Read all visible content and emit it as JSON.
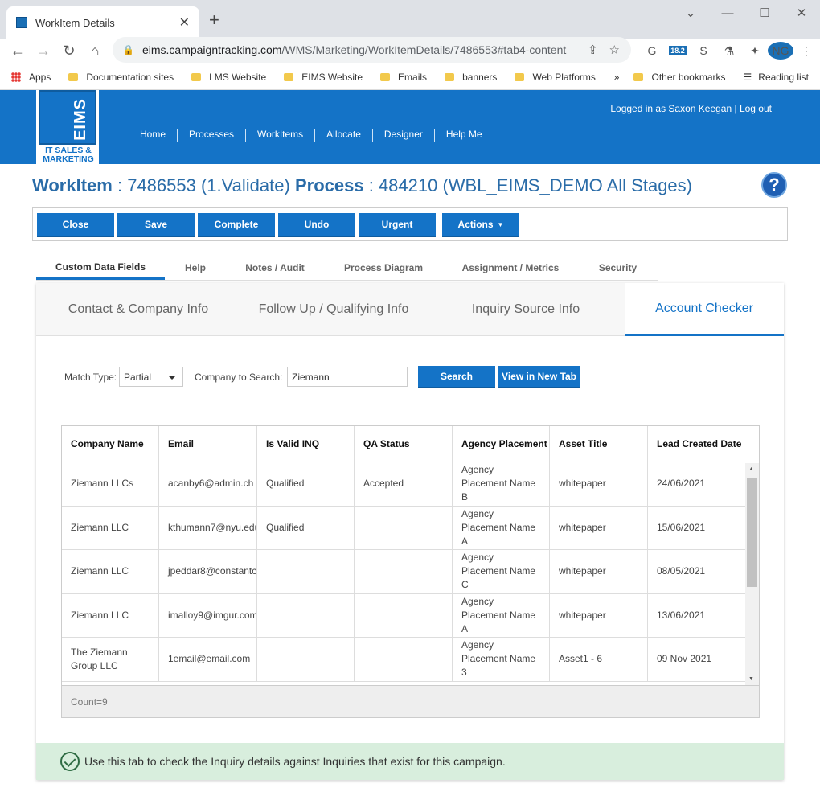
{
  "browser": {
    "tab_title": "WorkItem Details",
    "url_host": "eims.campaigntracking.com",
    "url_path": "/WMS/Marketing/WorkItemDetails/7486553#tab4-content",
    "bookmarks": [
      "Apps",
      "Documentation sites",
      "LMS Website",
      "EIMS Website",
      "Emails",
      "banners",
      "Web Platforms"
    ],
    "other_bookmarks": "Other bookmarks",
    "reading_list": "Reading list",
    "ext_badge": "18.2"
  },
  "header": {
    "logo_text": "EIMS",
    "logo_tagline": "IT SALES & MARKETING",
    "nav": [
      "Home",
      "Processes",
      "WorkItems",
      "Allocate",
      "Designer",
      "Help Me"
    ],
    "logged_in_prefix": "Logged in as",
    "user_name": "Saxon Keegan",
    "logout_label": "| Log out"
  },
  "title": {
    "workitem_label": "WorkItem",
    "workitem_value": ": 7486553 (1.Validate)",
    "process_label": "Process",
    "process_value": ": 484210 (WBL_EIMS_DEMO All Stages)"
  },
  "toolbar": {
    "close": "Close",
    "save": "Save",
    "complete": "Complete",
    "undo": "Undo",
    "urgent": "Urgent",
    "actions": "Actions"
  },
  "subtabs": [
    "Custom Data Fields",
    "Help",
    "Notes / Audit",
    "Process Diagram",
    "Assignment / Metrics",
    "Security"
  ],
  "innertabs": [
    "Contact & Company Info",
    "Follow Up / Qualifying Info",
    "Inquiry Source Info",
    "Account Checker"
  ],
  "search": {
    "match_type_label": "Match Type:",
    "match_type_value": "Partial",
    "company_label": "Company to Search:",
    "company_value": "Ziemann",
    "search_btn": "Search",
    "new_tab_btn": "View in New Tab"
  },
  "grid": {
    "columns": [
      "Company Name",
      "Email",
      "Is Valid INQ",
      "QA Status",
      "Agency Placement",
      "Asset Title",
      "Lead Created Date"
    ],
    "rows": [
      [
        "Ziemann LLCs",
        "acanby6@admin.ch",
        "Qualified",
        "Accepted",
        "Agency Placement Name B",
        "whitepaper",
        "24/06/2021"
      ],
      [
        "Ziemann LLC",
        "kthumann7@nyu.edu",
        "Qualified",
        "",
        "Agency Placement Name A",
        "whitepaper",
        "15/06/2021"
      ],
      [
        "Ziemann LLC",
        "jpeddar8@constantc",
        "",
        "",
        "Agency Placement Name C",
        "whitepaper",
        "08/05/2021"
      ],
      [
        "Ziemann LLC",
        "imalloy9@imgur.com",
        "",
        "",
        "Agency Placement Name A",
        "whitepaper",
        "13/06/2021"
      ],
      [
        "The Ziemann Group LLC",
        "1email@email.com",
        "",
        "",
        "Agency Placement Name 3",
        "Asset1 - 6",
        "09 Nov 2021"
      ]
    ],
    "count": "Count=9"
  },
  "notice": "Use this tab to check the Inquiry details against Inquiries that exist for this campaign."
}
